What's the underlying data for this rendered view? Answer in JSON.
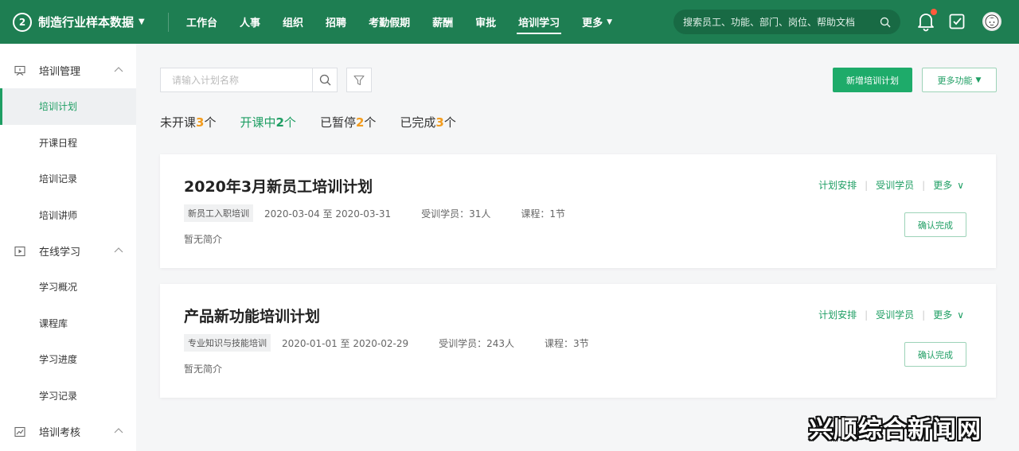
{
  "colors": {
    "brand": "#1e7e52",
    "accent": "#1e9e63",
    "count_highlight": "#f29c1f",
    "notification": "#ff5a3c"
  },
  "header": {
    "logo": "2",
    "title": "制造行业样本数据",
    "nav": [
      {
        "label": "工作台"
      },
      {
        "label": "人事"
      },
      {
        "label": "组织"
      },
      {
        "label": "招聘"
      },
      {
        "label": "考勤假期"
      },
      {
        "label": "薪酬"
      },
      {
        "label": "审批"
      },
      {
        "label": "培训学习"
      },
      {
        "label": "更多"
      }
    ],
    "search_placeholder": "搜索员工、功能、部门、岗位、帮助文档",
    "icons": [
      "bell-icon",
      "edit-icon",
      "avatar"
    ]
  },
  "sidebar": {
    "groups": [
      {
        "label": "培训管理",
        "icon": "training-icon",
        "items": [
          "培训计划",
          "开课日程",
          "培训记录",
          "培训讲师"
        ]
      },
      {
        "label": "在线学习",
        "icon": "video-icon",
        "items": [
          "学习概况",
          "课程库",
          "学习进度",
          "学习记录"
        ]
      },
      {
        "label": "培训考核",
        "icon": "chart-icon",
        "items": []
      }
    ],
    "active_item": "培训计划"
  },
  "toolbar": {
    "search_placeholder": "请输入计划名称",
    "new_plan_label": "新增培训计划",
    "more_label": "更多功能"
  },
  "status_tabs": [
    {
      "label": "未开课",
      "count": "3",
      "unit": "个"
    },
    {
      "label": "开课中",
      "count": "2",
      "unit": "个"
    },
    {
      "label": "已暂停",
      "count": "2",
      "unit": "个"
    },
    {
      "label": "已完成",
      "count": "3",
      "unit": "个"
    }
  ],
  "plans": [
    {
      "title": "2020年3月新员工培训计划",
      "tag": "新员工入职培训",
      "period": "2020-03-04 至 2020-03-31",
      "trainees": "受训学员：31人",
      "courses": "课程：1节",
      "desc": "暂无简介",
      "actions": [
        "计划安排",
        "受训学员",
        "更多"
      ],
      "confirm_label": "确认完成"
    },
    {
      "title": "产品新功能培训计划",
      "tag": "专业知识与技能培训",
      "period": "2020-01-01 至 2020-02-29",
      "trainees": "受训学员：243人",
      "courses": "课程：3节",
      "desc": "暂无简介",
      "actions": [
        "计划安排",
        "受训学员",
        "更多"
      ],
      "confirm_label": "确认完成"
    }
  ],
  "watermark": "兴顺综合新闻网"
}
